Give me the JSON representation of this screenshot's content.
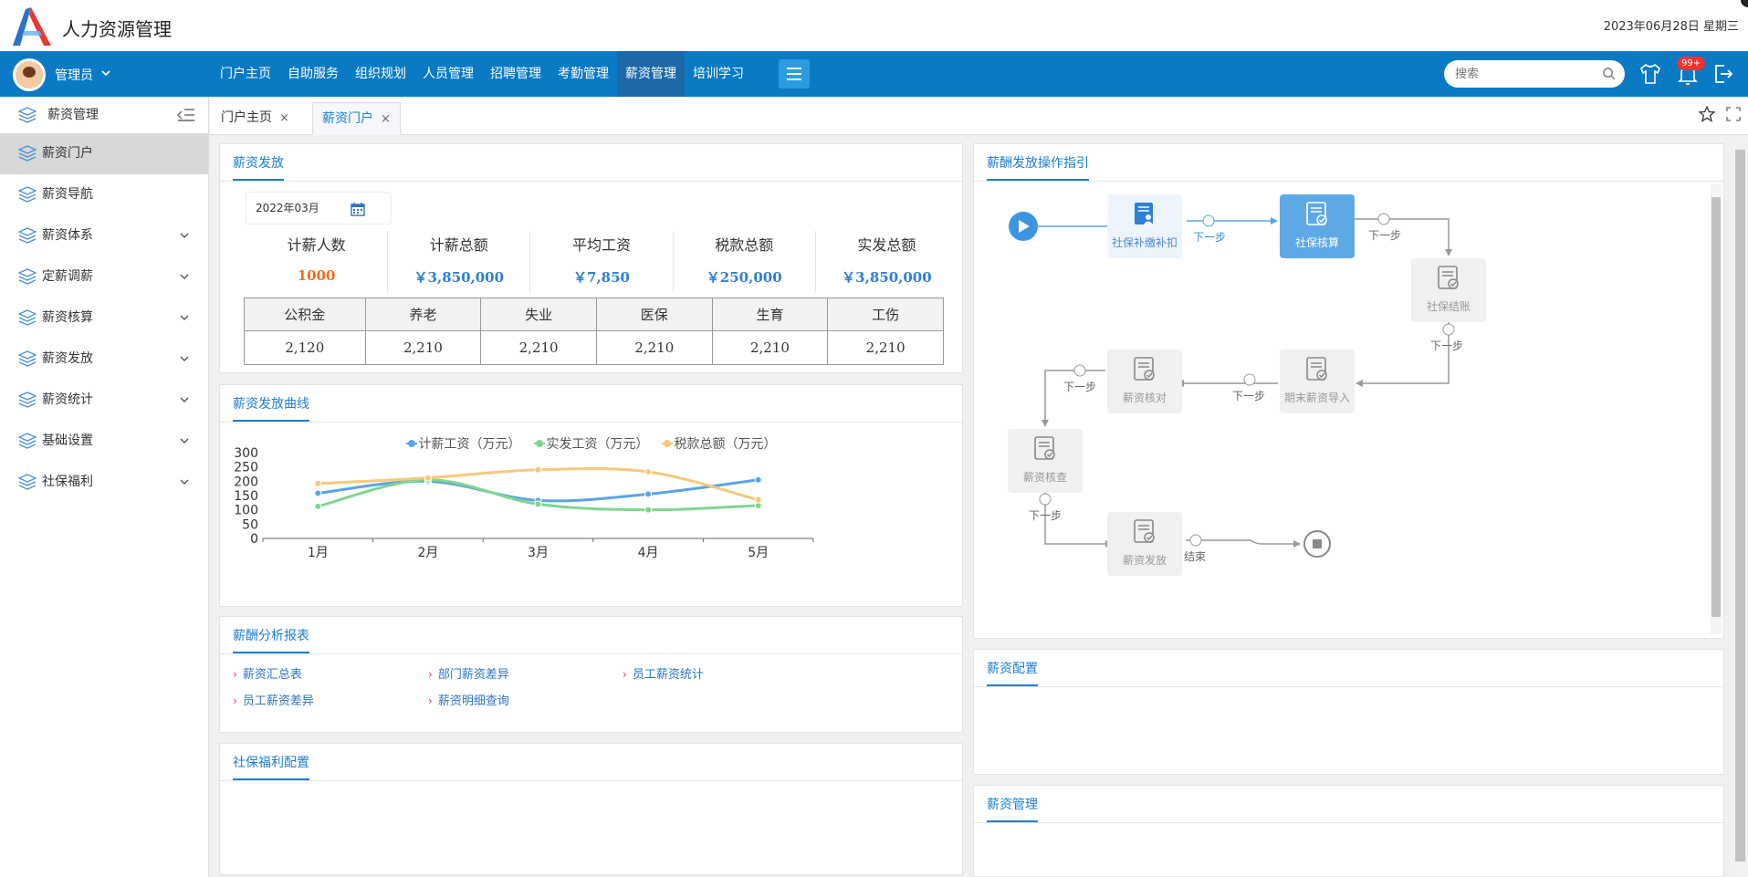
{
  "app": {
    "title": "人力资源管理",
    "date": "2023年06月28日  星期三"
  },
  "nav": {
    "user": "管理员",
    "items": [
      "门户主页",
      "自助服务",
      "组织规划",
      "人员管理",
      "招聘管理",
      "考勤管理",
      "薪资管理",
      "培训学习"
    ],
    "active_index": 6,
    "search_placeholder": "搜索",
    "badge": "99+"
  },
  "sidebar": {
    "header": "薪资管理",
    "items": [
      {
        "label": "薪资门户",
        "expandable": false
      },
      {
        "label": "薪资导航",
        "expandable": false
      },
      {
        "label": "薪资体系",
        "expandable": true
      },
      {
        "label": "定薪调薪",
        "expandable": true
      },
      {
        "label": "薪资核算",
        "expandable": true
      },
      {
        "label": "薪资发放",
        "expandable": true
      },
      {
        "label": "薪资统计",
        "expandable": true
      },
      {
        "label": "基础设置",
        "expandable": true
      },
      {
        "label": "社保福利",
        "expandable": true
      }
    ]
  },
  "tabs": [
    {
      "label": "门户主页",
      "active": false
    },
    {
      "label": "薪资门户",
      "active": true
    }
  ],
  "payroll": {
    "title": "薪资发放",
    "date_value": "2022年03月",
    "stats": [
      {
        "label": "计薪人数",
        "value": "1000"
      },
      {
        "label": "计薪总额",
        "value": "￥3,850,000"
      },
      {
        "label": "平均工资",
        "value": "￥7,850"
      },
      {
        "label": "税款总额",
        "value": "￥250,000"
      },
      {
        "label": "实发总额",
        "value": "￥3,850,000"
      }
    ],
    "insurance_headers": [
      "公积金",
      "养老",
      "失业",
      "医保",
      "生育",
      "工伤"
    ],
    "insurance_values": [
      "2,120",
      "2,210",
      "2,210",
      "2,210",
      "2,210",
      "2,210"
    ]
  },
  "curve": {
    "title": "薪资发放曲线"
  },
  "chart_data": {
    "type": "line",
    "categories": [
      "1月",
      "2月",
      "3月",
      "4月",
      "5月"
    ],
    "series": [
      {
        "name": "计薪工资（万元）",
        "values": [
          158,
          200,
          133,
          155,
          205
        ],
        "color": "#5aa4e6"
      },
      {
        "name": "实发工资（万元）",
        "values": [
          112,
          205,
          120,
          100,
          115
        ],
        "color": "#7fd68f"
      },
      {
        "name": "税款总额（万元）",
        "values": [
          192,
          212,
          240,
          233,
          135
        ],
        "color": "#f5c97b"
      }
    ],
    "yticks": [
      "300",
      "250",
      "200",
      "150",
      "100",
      "50",
      "0"
    ],
    "ylim": [
      0,
      300
    ],
    "legend": "top",
    "smooth": true
  },
  "reports": {
    "title": "薪酬分析报表",
    "links": [
      "薪资汇总表",
      "部门薪资差异",
      "员工薪资统计",
      "员工薪资差异",
      "薪资明细查询"
    ]
  },
  "welfare": {
    "title": "社保福利配置"
  },
  "guide": {
    "title": "薪酬发放操作指引",
    "nodes": [
      "社保补缴补扣",
      "社保核算",
      "社保结账",
      "期末薪资导入",
      "薪资核对",
      "薪资核查",
      "薪资发放"
    ],
    "step_label": "下一步",
    "end_label": "结束"
  },
  "config": {
    "title": "薪资配置"
  },
  "manage": {
    "title": "薪资管理"
  }
}
